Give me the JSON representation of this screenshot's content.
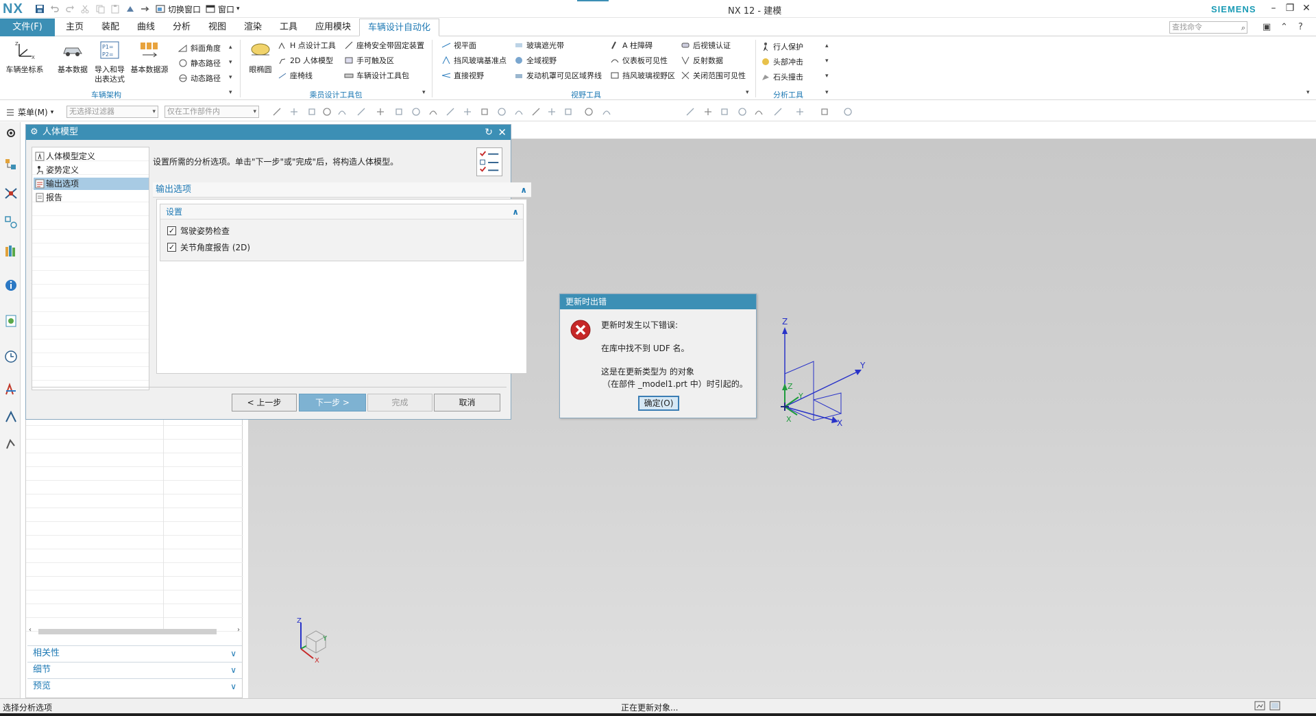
{
  "app": {
    "window_title": "NX 12 - 建模",
    "logo": "NX",
    "brand": "SIEMENS",
    "colors": {
      "accent": "#3c8fb5",
      "accent_text": "#1e79b4",
      "error": "#c62828"
    }
  },
  "quick_access": {
    "switch_window": "切换窗口",
    "window": "窗口"
  },
  "menu": {
    "file": "文件(F)",
    "tabs": [
      "主页",
      "装配",
      "曲线",
      "分析",
      "视图",
      "渲染",
      "工具",
      "应用模块",
      "车辆设计自动化"
    ],
    "active_tab": "车辆设计自动化",
    "search_placeholder": "查找命令"
  },
  "ribbon": {
    "vehicle_arch": {
      "label": "车辆架构",
      "buttons": [
        "车辆坐标系",
        "基本数据",
        "导入和导出表达式",
        "基本数据源"
      ],
      "small": [
        "斜面角度",
        "静态路径",
        "动态路径"
      ]
    },
    "occupant": {
      "label": "乘员设计工具包",
      "eyellipse": "眼椭圆",
      "small": [
        "H 点设计工具",
        "2D 人体模型",
        "座椅线",
        "座椅安全带固定装置",
        "手可触及区",
        "车辆设计工具包"
      ]
    },
    "vision": {
      "label": "视野工具",
      "small": [
        "视平面",
        "挡风玻璃基准点",
        "直接视野",
        "玻璃遮光带",
        "全域视野",
        "发动机罩可见区域界线",
        "A 柱障碍",
        "仪表板可见性",
        "挡风玻璃视野区",
        "后视镜认证",
        "反射数据",
        "关闭范围可见性"
      ]
    },
    "analysis": {
      "label": "分析工具",
      "small": [
        "行人保护",
        "头部冲击",
        "石头撞击"
      ]
    }
  },
  "toolbar": {
    "menu": "菜单(M)",
    "filter": "无选择过滤器",
    "scope": "仅在工作部件内"
  },
  "human_model_dialog": {
    "title": "人体模型",
    "steps": [
      "人体模型定义",
      "姿势定义",
      "输出选项",
      "报告"
    ],
    "selected_step": "输出选项",
    "instruction": "设置所需的分析选项。单击\"下一步\"或\"完成\"后，将构造人体模型。",
    "output_section": "输出选项",
    "settings_section": "设置",
    "checkboxes": [
      {
        "label": "驾驶姿势检查",
        "checked": true
      },
      {
        "label": "关节角度报告 (2D)",
        "checked": true
      }
    ],
    "buttons": {
      "back": "< 上一步",
      "next": "下一步 >",
      "finish": "完成",
      "cancel": "取消"
    }
  },
  "error_dialog": {
    "title": "更新时出错",
    "line1": "更新时发生以下错误:",
    "line2": "在库中找不到 UDF 名。",
    "line3": "这是在更新类型为  的对象",
    "line4": "（在部件 _model1.prt 中）时引起的。",
    "ok": "确定(O)"
  },
  "navigator": {
    "sections": [
      "相关性",
      "细节",
      "预览"
    ]
  },
  "axes": {
    "x": "X",
    "y": "Y",
    "z": "Z"
  },
  "status": {
    "left": "选择分析选项",
    "center": "正在更新对象..."
  }
}
